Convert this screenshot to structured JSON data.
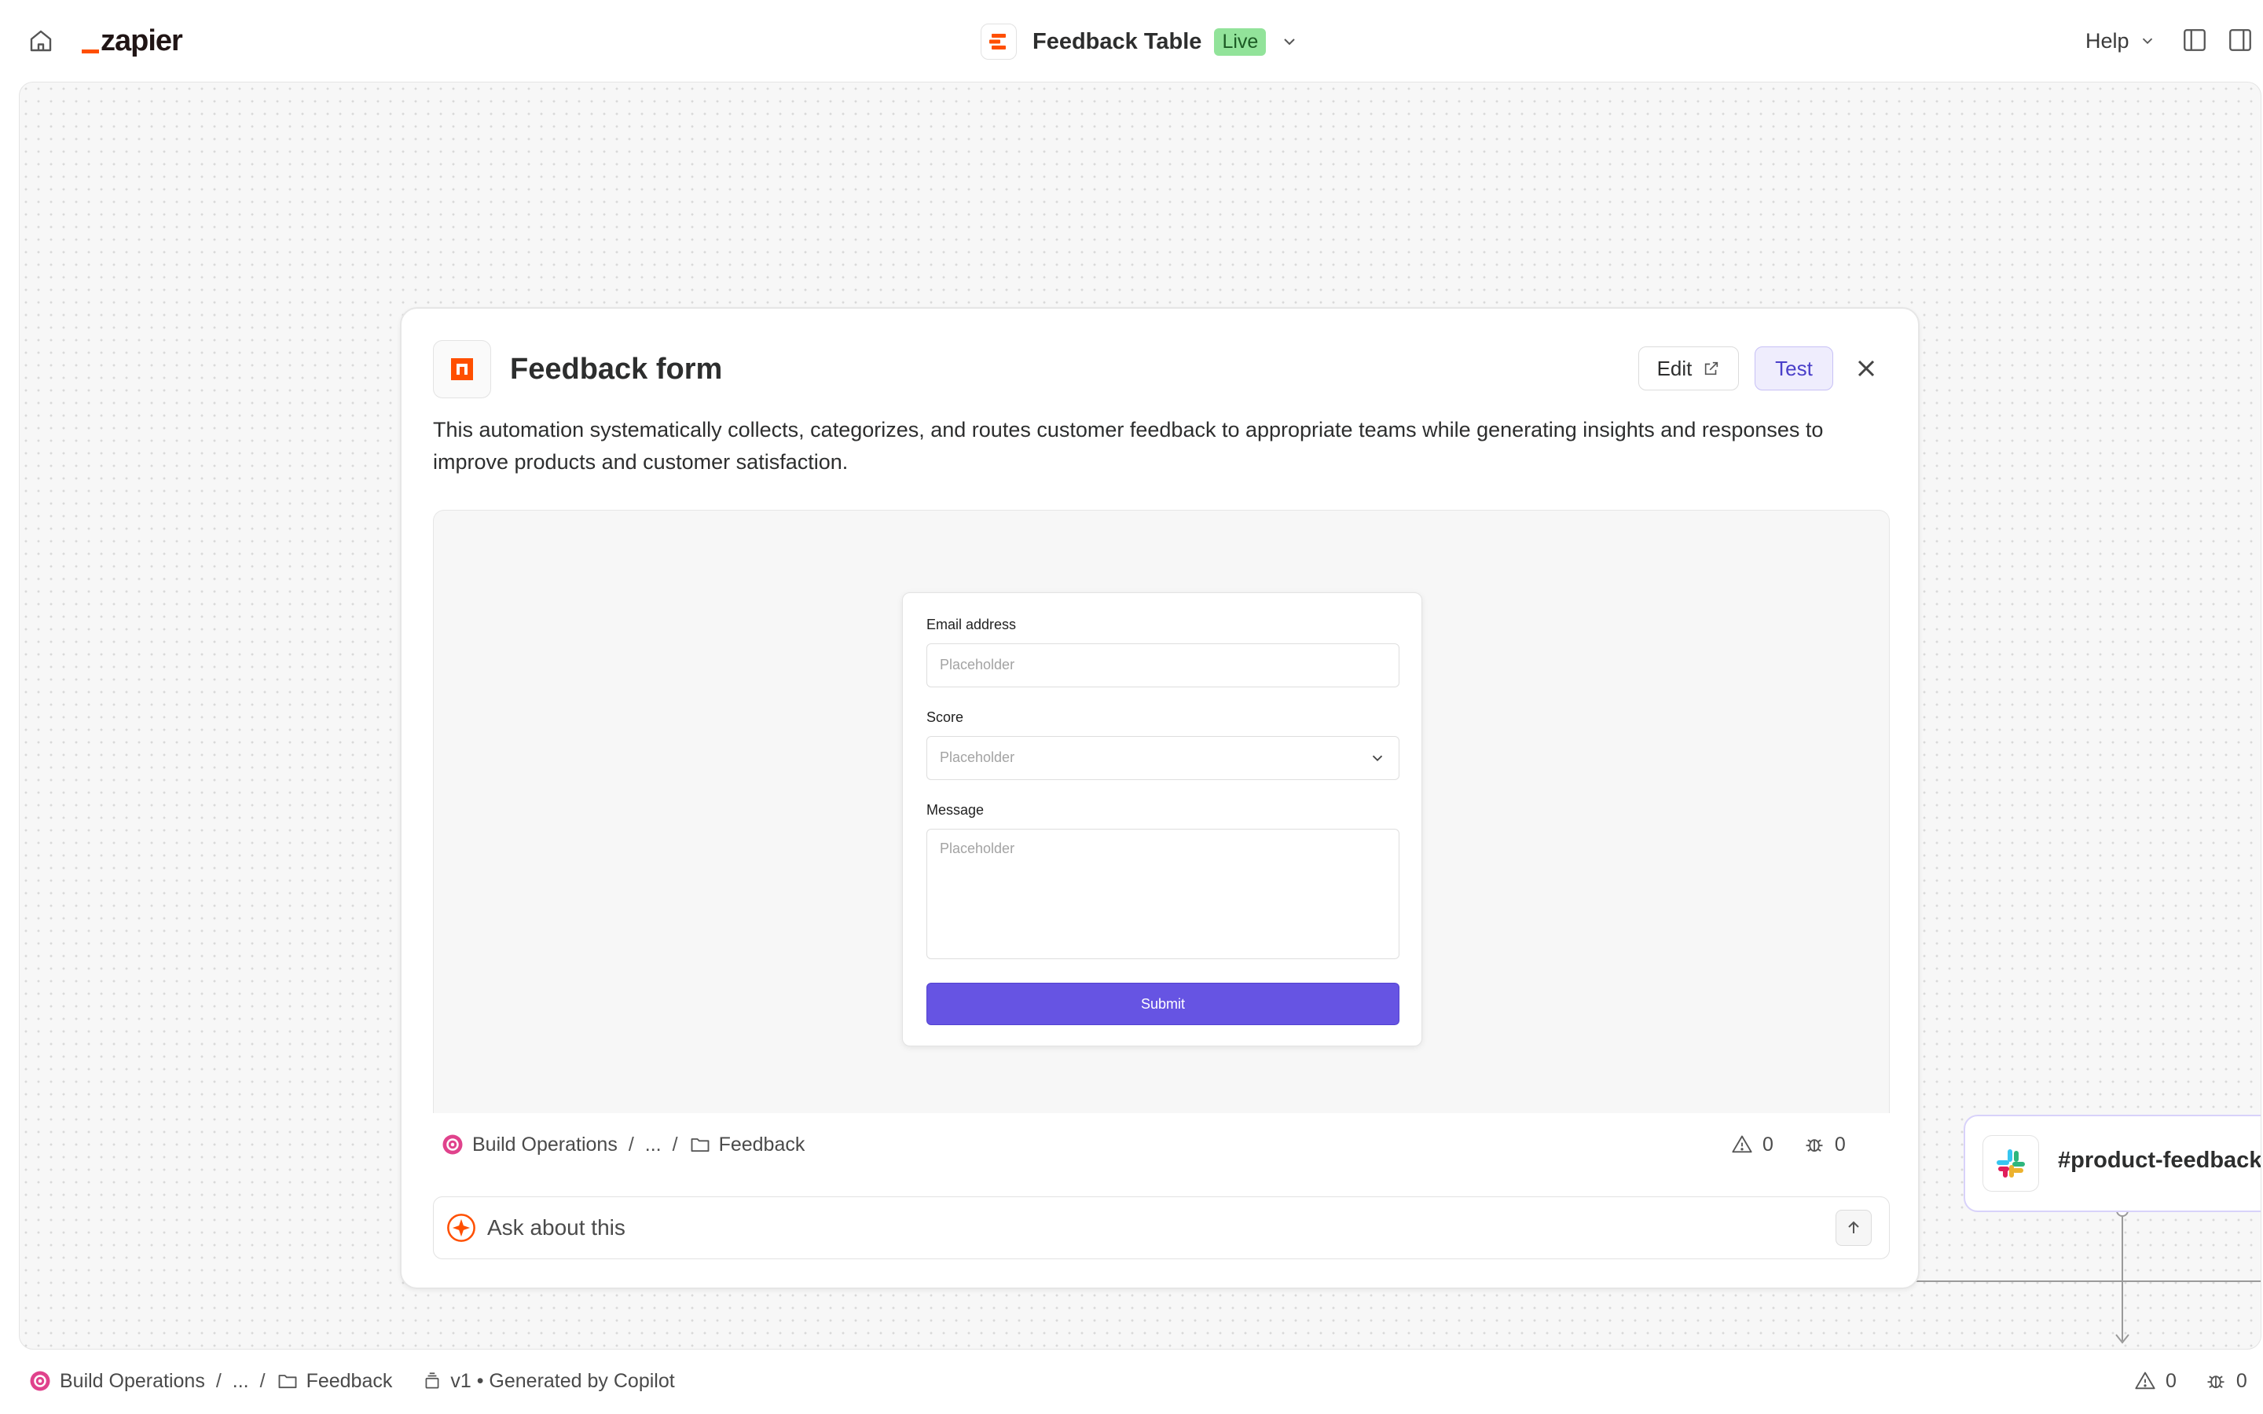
{
  "app": {
    "brand": "zapier",
    "brand_color": "#ff4f00"
  },
  "header": {
    "title": "Feedback Table",
    "status_badge": "Live",
    "help_label": "Help"
  },
  "card": {
    "title": "Feedback form",
    "edit_label": "Edit",
    "test_label": "Test",
    "description": "This automation systematically collects, categorizes, and routes customer feedback to appropriate teams while generating insights and responses to improve products and customer satisfaction.",
    "form": {
      "fields": [
        {
          "label": "Email address",
          "placeholder": "Placeholder",
          "type": "text"
        },
        {
          "label": "Score",
          "placeholder": "Placeholder",
          "type": "select"
        },
        {
          "label": "Message",
          "placeholder": "Placeholder",
          "type": "textarea"
        }
      ],
      "submit_label": "Submit",
      "submit_color": "#6654e3"
    },
    "breadcrumb": {
      "root": "Build Operations",
      "ellipsis": "...",
      "folder": "Feedback"
    },
    "warnings_count": "0",
    "errors_count": "0",
    "ask_placeholder": "Ask about this"
  },
  "canvas": {
    "slack_node": {
      "channel": "#product-feedback"
    }
  },
  "statusbar": {
    "breadcrumb": {
      "root": "Build Operations",
      "ellipsis": "...",
      "folder": "Feedback"
    },
    "version": "v1 • Generated by Copilot",
    "warnings_count": "0",
    "errors_count": "0"
  }
}
